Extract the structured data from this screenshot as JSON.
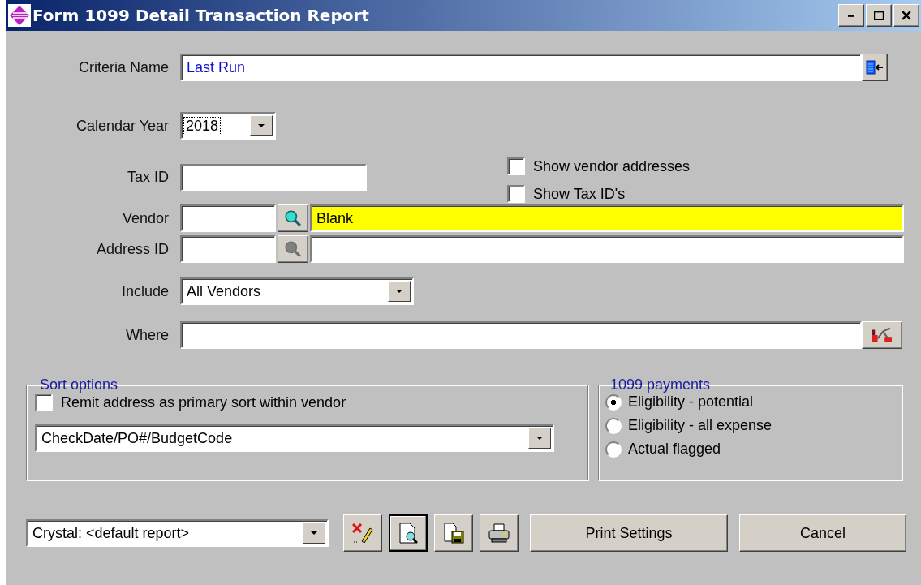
{
  "window": {
    "title": "Form 1099 Detail Transaction Report"
  },
  "criteria_name": {
    "label": "Criteria Name",
    "value": "Last Run"
  },
  "calendar_year": {
    "label": "Calendar Year",
    "value": "2018"
  },
  "tax_id": {
    "label": "Tax ID"
  },
  "options": [
    {
      "label": "Show vendor addresses",
      "checked": false
    },
    {
      "label": "Show Tax ID's",
      "checked": false
    }
  ],
  "vendor": {
    "label": "Vendor",
    "name": "Blank",
    "highlighted": true
  },
  "address_id": {
    "label": "Address ID",
    "lookup_disabled": true
  },
  "include": {
    "label": "Include",
    "value": "All Vendors"
  },
  "where": {
    "label": "Where"
  },
  "sort_options": {
    "title": "Sort options",
    "remit": {
      "label": "Remit address as primary sort within vendor",
      "checked": false
    },
    "sort_order": "CheckDate/PO#/BudgetCode"
  },
  "payments": {
    "title": "1099 payments",
    "choices": [
      {
        "label": "Eligibility - potential",
        "selected": true
      },
      {
        "label": "Eligibility - all expense",
        "selected": false
      },
      {
        "label": "Actual flagged",
        "selected": false
      }
    ]
  },
  "report": "Crystal: <default report>",
  "toolbar": [
    {
      "kind": "clear",
      "pressed": false
    },
    {
      "kind": "preview",
      "pressed": true
    },
    {
      "kind": "export",
      "pressed": false
    },
    {
      "kind": "print",
      "pressed": false
    }
  ],
  "buttons": [
    "Print Settings",
    "Cancel"
  ]
}
